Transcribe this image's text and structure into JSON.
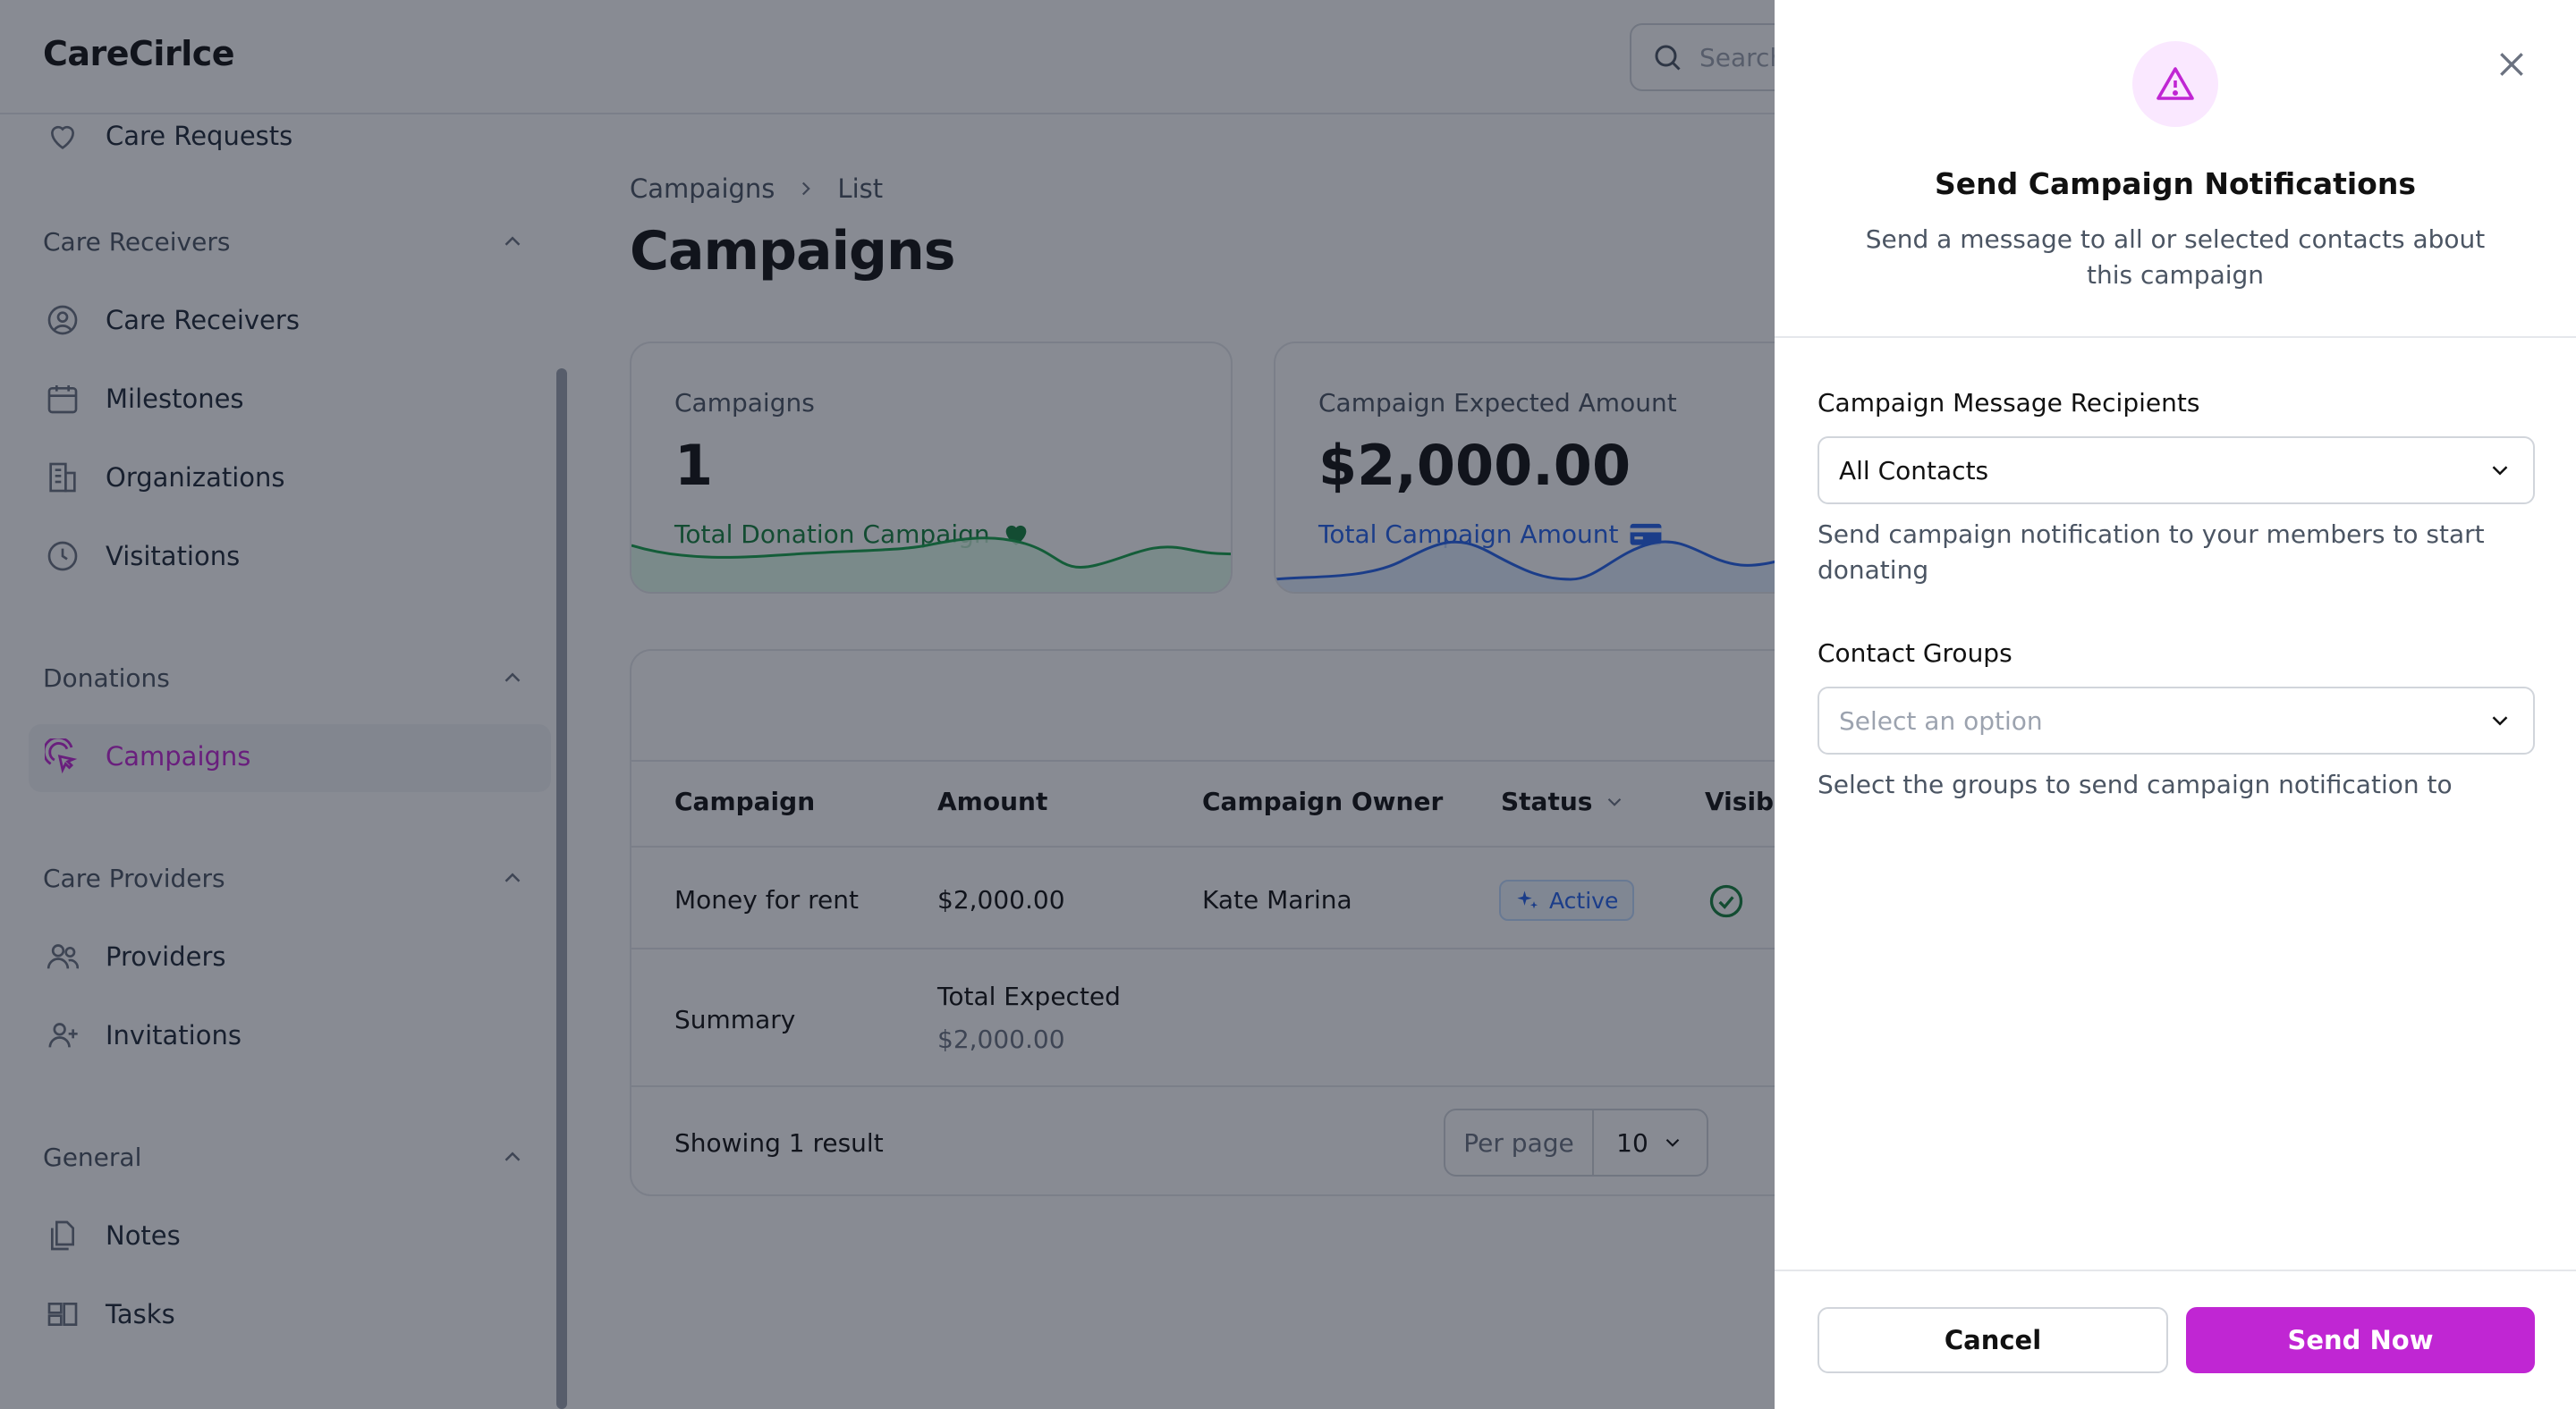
{
  "app": {
    "name": "CareCirlce"
  },
  "search": {
    "placeholder": "Search"
  },
  "sidebar": {
    "top_item": "Care Requests",
    "groups": [
      {
        "label": "Care Receivers",
        "items": [
          "Care Receivers",
          "Milestones",
          "Organizations",
          "Visitations"
        ]
      },
      {
        "label": "Donations",
        "items": [
          "Campaigns"
        ]
      },
      {
        "label": "Care Providers",
        "items": [
          "Providers",
          "Invitations"
        ]
      },
      {
        "label": "General",
        "items": [
          "Notes",
          "Tasks"
        ]
      }
    ],
    "active_item": "Campaigns"
  },
  "breadcrumb": [
    "Campaigns",
    "List"
  ],
  "page": {
    "title": "Campaigns"
  },
  "stats": [
    {
      "label": "Campaigns",
      "value": "1",
      "description": "Total Donation Campaign",
      "color": "#15803d",
      "icon": "heart-icon"
    },
    {
      "label": "Campaign Expected Amount",
      "value": "$2,000.00",
      "description": "Total Campaign Amount",
      "color": "#2563eb",
      "icon": "credit-card-icon"
    }
  ],
  "table": {
    "columns": [
      "Campaign",
      "Amount",
      "Campaign Owner",
      "Status",
      "Visibil"
    ],
    "rows": [
      {
        "campaign": "Money for rent",
        "amount": "$2,000.00",
        "owner": "Kate Marina",
        "status": "Active",
        "visible": true
      }
    ],
    "summary": {
      "label": "Summary",
      "total_label": "Total Expected",
      "total_value": "$2,000.00"
    },
    "footer": {
      "showing": "Showing 1 result",
      "per_page_label": "Per page",
      "per_page_value": "10"
    }
  },
  "modal": {
    "title": "Send Campaign Notifications",
    "subtitle": "Send a message to all or selected contacts about this campaign",
    "recipients": {
      "label": "Campaign Message Recipients",
      "value": "All Contacts",
      "helper": "Send campaign notification to your members to start donating"
    },
    "groups": {
      "label": "Contact Groups",
      "placeholder": "Select an option",
      "helper": "Select the groups to send campaign notification to"
    },
    "cancel_label": "Cancel",
    "send_label": "Send Now",
    "accent": "#c026d3"
  }
}
